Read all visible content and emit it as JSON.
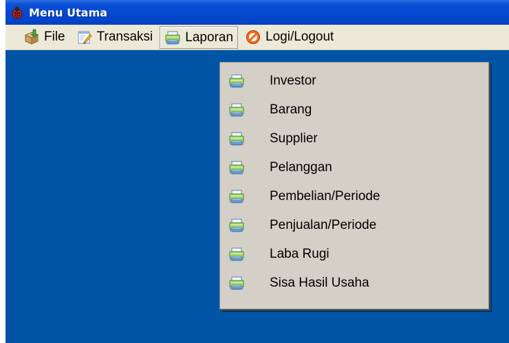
{
  "window": {
    "title": "Menu Utama",
    "desktop_color": "#0054a6"
  },
  "menubar": {
    "items": [
      {
        "label": "File",
        "icon": "package-icon"
      },
      {
        "label": "Transaksi",
        "icon": "notepad-icon"
      },
      {
        "label": "Laporan",
        "icon": "printer-icon",
        "active": true
      },
      {
        "label": "Logi/Logout",
        "icon": "no-entry-icon"
      }
    ]
  },
  "laporan_menu": {
    "items": [
      {
        "label": "Investor",
        "icon": "printer-icon"
      },
      {
        "label": "Barang",
        "icon": "printer-icon"
      },
      {
        "label": "Supplier",
        "icon": "printer-icon"
      },
      {
        "label": "Pelanggan",
        "icon": "printer-icon"
      },
      {
        "label": "Pembelian/Periode",
        "icon": "printer-icon"
      },
      {
        "label": "Penjualan/Periode",
        "icon": "printer-icon"
      },
      {
        "label": "Laba Rugi",
        "icon": "printer-icon"
      },
      {
        "label": "Sisa Hasil Usaha",
        "icon": "printer-icon"
      }
    ]
  }
}
